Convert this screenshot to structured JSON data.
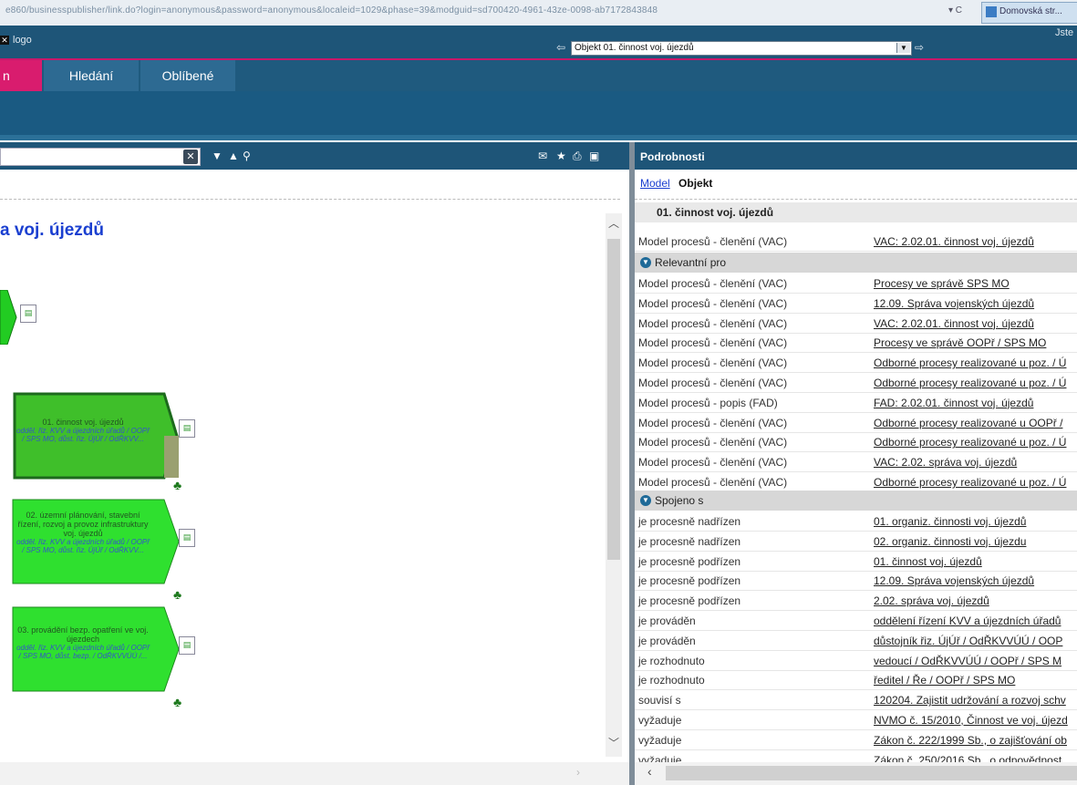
{
  "browser": {
    "url": "e860/businesspublisher/link.do?login=anonymous&password=anonymous&localeid=1029&phase=39&modguid=sd700420-4961-43ze-0098-ab7172843848",
    "tab_label": "Domovská str...",
    "urlbar_icons": "▾ C"
  },
  "header": {
    "logo_text": "logo",
    "user_label": "Jste",
    "object_select_value": "Objekt 01. činnost voj. újezdů"
  },
  "tabs": [
    {
      "label": "n"
    },
    {
      "label": "Hledání"
    },
    {
      "label": "Oblíbené"
    }
  ],
  "diagram": {
    "title": "a voj. újezdů",
    "processes": [
      {
        "title": "01. činnost voj. újezdů",
        "sub": "odděl. řiz. KVV a újezdních úřadů / OOPř / SPS MO, důst. řiz. ÚjÚř / OdŘKVV..."
      },
      {
        "title": "02. územní plánování, stavební řízení, rozvoj a provoz infrastruktury voj. újezdů",
        "sub": "odděl. řiz. KVV a újezdních úřadů / OOPř / SPS MO, důst. řiz. ÚjÚř / OdŘKVV..."
      },
      {
        "title": "03. provádění bezp. opatření ve voj. újezdech",
        "sub": "odděl. řiz. KVV a újezdních úřadů / OOPř / SPS MO, důst. bezp. / OdŘKVVÚÚ /..."
      }
    ]
  },
  "details": {
    "title": "Podrobnosti",
    "tab_model": "Model",
    "tab_objekt": "Objekt",
    "object_name": "01. činnost voj. újezdů",
    "top_row": {
      "k": "Model procesů - členění (VAC)",
      "v": "VAC: 2.02.01. činnost voj. újezdů"
    },
    "group1": "Relevantní pro",
    "relevant": [
      {
        "k": "Model procesů - členění (VAC)",
        "v": "Procesy ve správě SPS MO"
      },
      {
        "k": "Model procesů - členění (VAC)",
        "v": "12.09. Správa vojenských újezdů"
      },
      {
        "k": "Model procesů - členění (VAC)",
        "v": "VAC: 2.02.01. činnost voj. újezdů"
      },
      {
        "k": "Model procesů - členění (VAC)",
        "v": "Procesy ve správě OOPř / SPS MO"
      },
      {
        "k": "Model procesů - členění (VAC)",
        "v": "Odborné procesy realizované u poz. / Ú"
      },
      {
        "k": "Model procesů - členění (VAC)",
        "v": "Odborné procesy realizované u poz. / Ú"
      },
      {
        "k": "Model procesů - popis (FAD)",
        "v": "FAD: 2.02.01. činnost voj. újezdů"
      },
      {
        "k": "Model procesů - členění (VAC)",
        "v": "Odborné procesy realizované u OOPř /"
      },
      {
        "k": "Model procesů - členění (VAC)",
        "v": "Odborné procesy realizované u poz. / Ú"
      },
      {
        "k": "Model procesů - členění (VAC)",
        "v": "VAC: 2.02. správa voj. újezdů"
      },
      {
        "k": "Model procesů - členění (VAC)",
        "v": "Odborné procesy realizované u poz. / Ú"
      }
    ],
    "group2": "Spojeno s",
    "connected": [
      {
        "k": "je procesně nadřízen",
        "v": "01. organiz. činnosti voj. újezdů"
      },
      {
        "k": "je procesně nadřízen",
        "v": "02. organiz. činnosti voj. újezdu"
      },
      {
        "k": "je procesně podřízen",
        "v": "01. činnost voj. újezdů"
      },
      {
        "k": "je procesně podřízen",
        "v": "12.09. Správa vojenských újezdů"
      },
      {
        "k": "je procesně podřízen",
        "v": "2.02. správa voj. újezdů"
      },
      {
        "k": "je prováděn",
        "v": "oddělení řízení KVV a újezdních úřadů"
      },
      {
        "k": "je prováděn",
        "v": "důstojník řiz. ÚjÚř / OdŘKVVÚÚ / OOP"
      },
      {
        "k": "je rozhodnuto",
        "v": "vedoucí / OdŘKVVÚÚ / OOPř / SPS M"
      },
      {
        "k": "je rozhodnuto",
        "v": "ředitel / Ře / OOPř / SPS MO"
      },
      {
        "k": "souvisí s",
        "v": "120204. Zajistit udržování a rozvoj schv"
      },
      {
        "k": "vyžaduje",
        "v": "NVMO č. 15/2010, Činnost ve voj. újezd"
      },
      {
        "k": "vyžaduje",
        "v": "Zákon č. 222/1999 Sb., o zajišťování ob"
      },
      {
        "k": "vyžaduje",
        "v": "Zákon č. 250/2016 Sb., o odpovědnost"
      }
    ]
  }
}
